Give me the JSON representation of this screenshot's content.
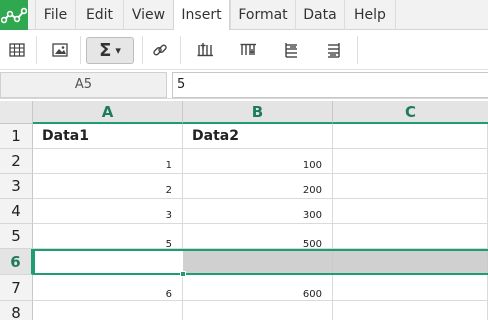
{
  "menubar": {
    "logo": "app-logo",
    "items": [
      {
        "label": "File"
      },
      {
        "label": "Edit"
      },
      {
        "label": "View"
      },
      {
        "label": "Insert",
        "active": true
      },
      {
        "label": "Format"
      },
      {
        "label": "Data"
      },
      {
        "label": "Help"
      }
    ]
  },
  "toolbar": {
    "buttons": [
      "table-icon",
      "image-icon",
      "sum-icon",
      "link-icon",
      "insert-column-before-icon",
      "insert-column-after-icon",
      "insert-row-before-icon",
      "insert-row-after-icon"
    ],
    "sum_symbol": "Σ",
    "sum_arrow": "▾"
  },
  "formula": {
    "cell_ref": "A5",
    "value": "5"
  },
  "grid": {
    "columns": [
      "A",
      "B",
      "C"
    ],
    "rows": [
      {
        "num": "1",
        "a": "Data1",
        "b": "Data2"
      },
      {
        "num": "2",
        "a": "1",
        "b": "100"
      },
      {
        "num": "3",
        "a": "2",
        "b": "200"
      },
      {
        "num": "4",
        "a": "3",
        "b": "300"
      },
      {
        "num": "5",
        "a": "5",
        "b": "500"
      },
      {
        "num": "6",
        "a": "",
        "b": ""
      },
      {
        "num": "7",
        "a": "6",
        "b": "600"
      },
      {
        "num": "8",
        "a": "",
        "b": ""
      }
    ],
    "selected_row": "6"
  },
  "colors": {
    "accent": "#1e9d73",
    "logo_bg": "#2fa84f"
  }
}
